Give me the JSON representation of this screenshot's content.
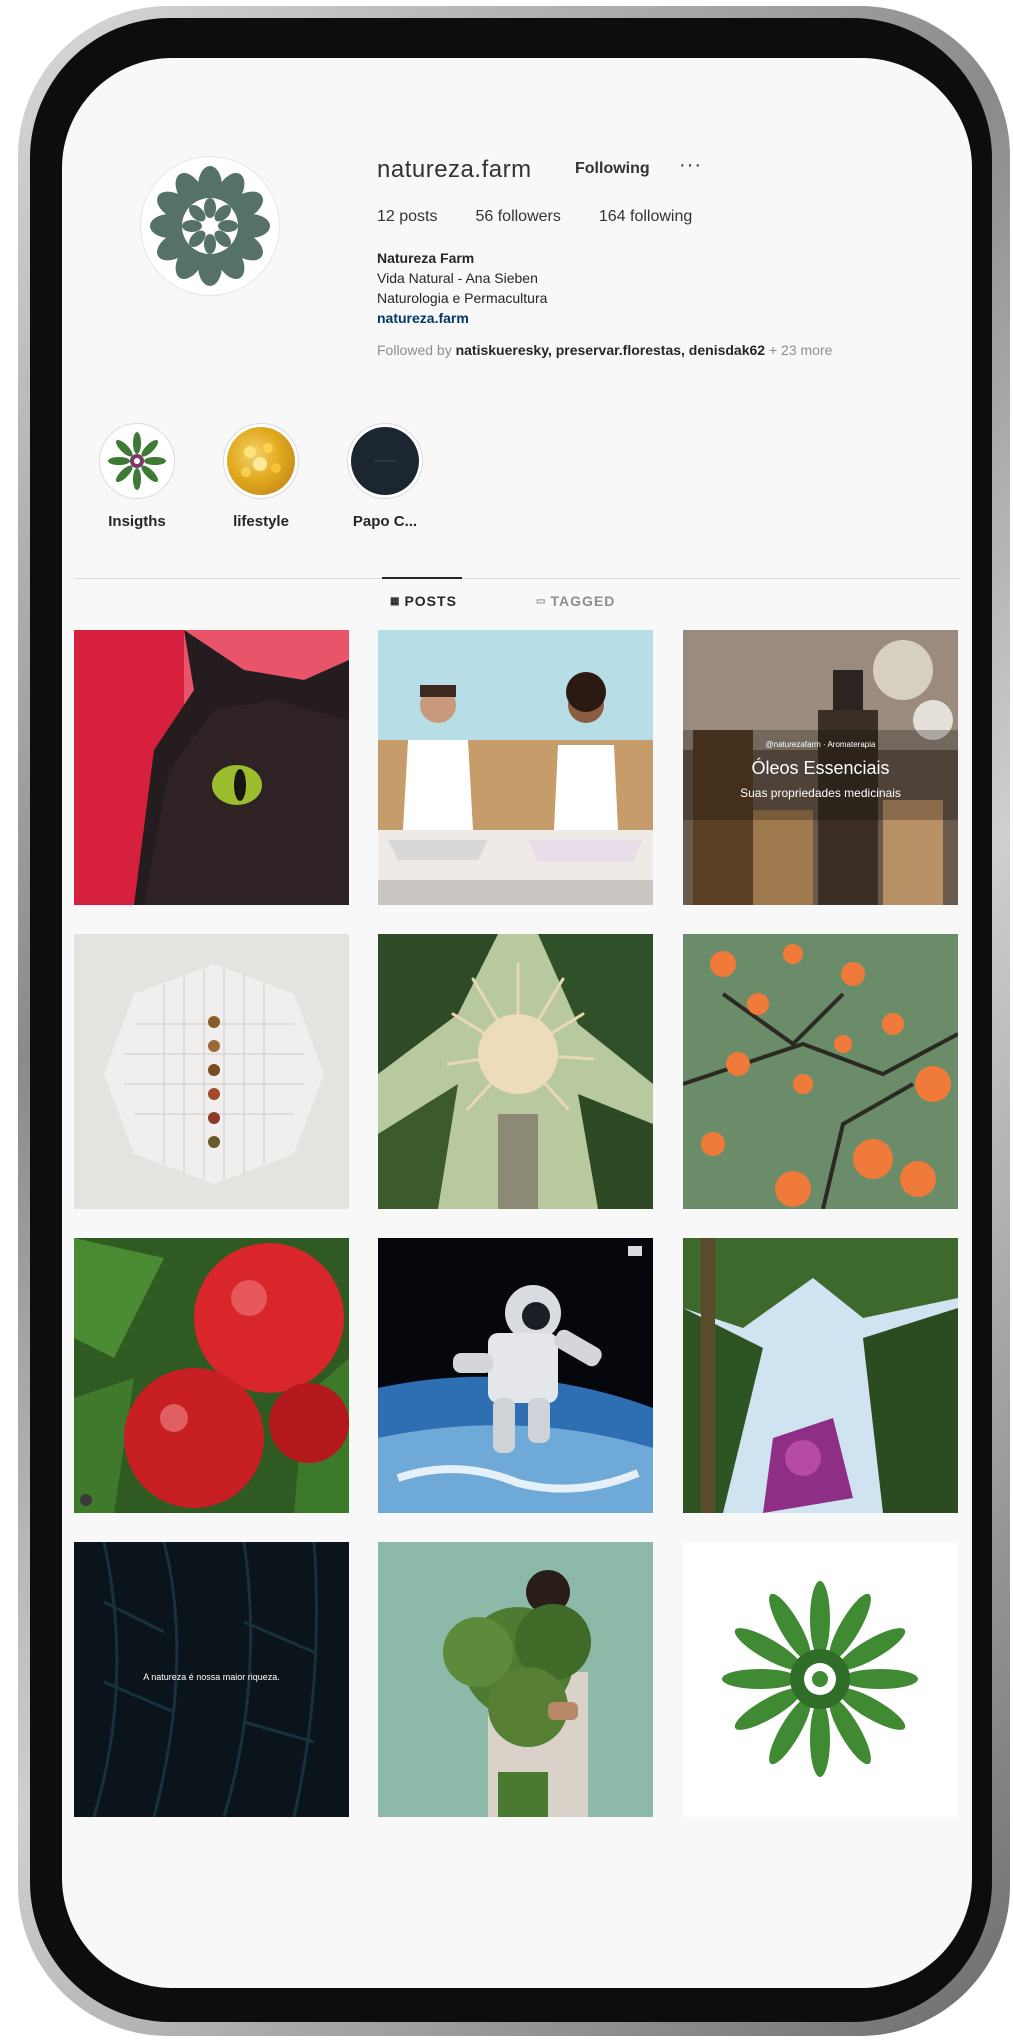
{
  "profile": {
    "username": "natureza.farm",
    "follow_label": "Following",
    "more_label": "···",
    "posts": "12 posts",
    "followers": "56 followers",
    "following": "164 following",
    "full_name": "Natureza Farm",
    "bio_line1": "Vida Natural - Ana Sieben",
    "bio_line2": "Naturologia e Permacultura",
    "link": "natureza.farm",
    "followed_prefix": "Followed by ",
    "followed_names": "natiskueresky, preservar.florestas, denisdak62",
    "followed_suffix": " + 23 more"
  },
  "highlights": [
    {
      "label": "Insigths"
    },
    {
      "label": "lifestyle"
    },
    {
      "label": "Papo C..."
    }
  ],
  "tabs": {
    "posts": "POSTS",
    "tagged": "TAGGED"
  },
  "posts": [
    {
      "name": "cat"
    },
    {
      "name": "couple-meditating"
    },
    {
      "name": "essential-oils",
      "small": "@naturezafarm · Aromaterapia",
      "title": "Óleos Essenciais",
      "subtitle": "Suas propriedades medicinais"
    },
    {
      "name": "seeds-on-cloth"
    },
    {
      "name": "palm-flower"
    },
    {
      "name": "orange-tree"
    },
    {
      "name": "tomatoes"
    },
    {
      "name": "astronaut"
    },
    {
      "name": "forest-canopy"
    },
    {
      "name": "dark-leaves",
      "caption": "A natureza é nossa maior riqueza."
    },
    {
      "name": "person-with-plants"
    },
    {
      "name": "leaf-mandala"
    }
  ],
  "colors": {
    "link": "#00376b",
    "text": "#262626",
    "muted": "#8e8e8e",
    "mandala": "#56706a"
  }
}
